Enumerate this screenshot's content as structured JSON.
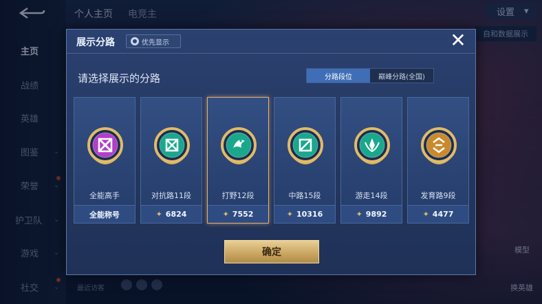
{
  "background": {
    "sidebar": {
      "items": [
        {
          "label": "主页",
          "active": true
        },
        {
          "label": "战绩"
        },
        {
          "label": "英雄"
        },
        {
          "label": "图鉴"
        },
        {
          "label": "荣誉"
        },
        {
          "label": "护卫队"
        },
        {
          "label": "游戏"
        },
        {
          "label": "社交"
        }
      ]
    },
    "top_tabs": [
      "个人主页",
      "电竞主"
    ],
    "settings_label": "设置",
    "right_button": "自和数据展示",
    "recent_visitors": "最近访客",
    "model_label": "模型",
    "swap_hero_label": "换英雄"
  },
  "modal": {
    "title": "展示分路",
    "priority_button": "优先显示",
    "close_symbol": "✕",
    "subtitle": "请选择展示的分路",
    "segments": [
      "分路段位",
      "巅峰分路(全国)"
    ],
    "active_segment": 0,
    "cards": [
      {
        "name": "全能高手",
        "footer": "全能称号",
        "has_points": false,
        "icon": "allround-emblem-icon",
        "color": "#b03fc9"
      },
      {
        "name": "对抗路11段",
        "footer": "6824",
        "has_points": true,
        "icon": "clash-lane-emblem-icon",
        "color": "#19a88c"
      },
      {
        "name": "打野12段",
        "footer": "7552",
        "has_points": true,
        "icon": "jungle-emblem-icon",
        "color": "#19a88c",
        "selected": true
      },
      {
        "name": "中路15段",
        "footer": "10316",
        "has_points": true,
        "icon": "mid-lane-emblem-icon",
        "color": "#19a88c"
      },
      {
        "name": "游走14段",
        "footer": "9892",
        "has_points": true,
        "icon": "roam-emblem-icon",
        "color": "#19a88c"
      },
      {
        "name": "发育路9段",
        "footer": "4477",
        "has_points": true,
        "icon": "farm-lane-emblem-icon",
        "color": "#c98a2e"
      }
    ],
    "confirm_label": "确定"
  }
}
